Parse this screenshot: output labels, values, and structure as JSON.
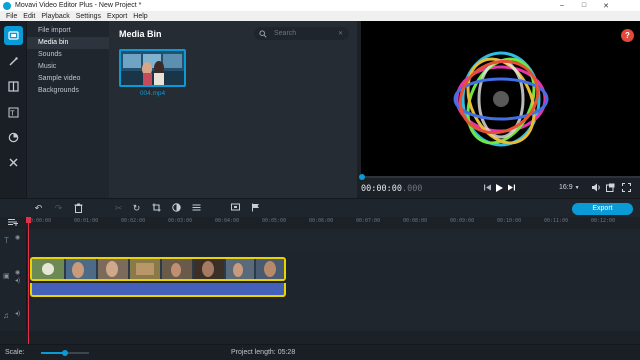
{
  "window": {
    "title": "Movavi Video Editor Plus - New Project *",
    "controls": [
      "–",
      "□",
      "✕"
    ]
  },
  "menu": [
    "File",
    "Edit",
    "Playback",
    "Settings",
    "Export",
    "Help"
  ],
  "import_nav": [
    "File import",
    "Media bin",
    "Sounds",
    "Music",
    "Sample video",
    "Backgrounds"
  ],
  "media_bin": {
    "title": "Media Bin",
    "search_placeholder": "Search",
    "file_name": "004.mp4"
  },
  "player": {
    "timecode_main": "00:00:00",
    "timecode_ms": ".000",
    "aspect_ratio": "16:9",
    "help": "?"
  },
  "toolbar": {
    "export_label": "Export"
  },
  "timeline": {
    "ruler_ticks": [
      "00:00:00",
      "00:01:00",
      "00:02:00",
      "00:03:00",
      "00:04:00",
      "00:05:00",
      "00:06:00",
      "00:07:00",
      "00:08:00",
      "00:09:00",
      "00:10:00",
      "00:11:00",
      "00:12:00"
    ]
  },
  "status": {
    "scale_label": "Scale:",
    "scale_level": 0.5,
    "project_length_label": "Project length:",
    "project_length_value": "05:28"
  },
  "colors": {
    "accent": "#0a9ad6",
    "clip_border": "#e9d400",
    "playhead": "#e0314a",
    "help_button": "#e04a38"
  }
}
